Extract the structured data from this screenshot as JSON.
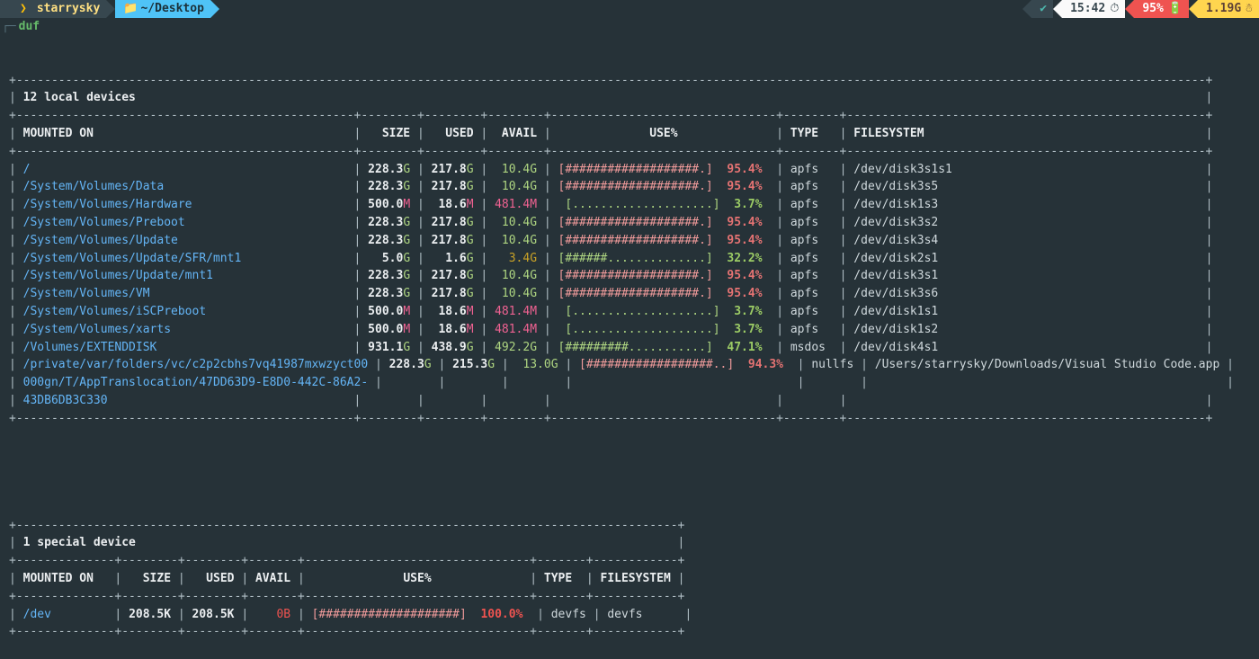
{
  "prompt": {
    "os_icon": "",
    "user": "starrysky",
    "dir_icon": "📁",
    "dir": "~/Desktop",
    "status_icon": "✔",
    "time": "15:42",
    "clock_icon": "◴",
    "battery_pct": "95%",
    "battery_icon": "🔋",
    "memory": "1.19G",
    "memory_icon": "⛁",
    "corner": "┌─",
    "command": "duf"
  },
  "local": {
    "title": "12 local devices",
    "columns": [
      "MOUNTED ON",
      "SIZE",
      "USED",
      "AVAIL",
      "USE%",
      "TYPE",
      "FILESYSTEM"
    ],
    "rows": [
      {
        "mount": "/",
        "size": "228.3G",
        "used": "217.8G",
        "avail": "10.4G",
        "avail_mag": "G",
        "bar_fill": 19,
        "bar_total": 20,
        "pct": "95.4%",
        "pct_level": "hi",
        "type": "apfs",
        "fs": "/dev/disk3s1s1"
      },
      {
        "mount": "/System/Volumes/Data",
        "size": "228.3G",
        "used": "217.8G",
        "avail": "10.4G",
        "avail_mag": "G",
        "bar_fill": 19,
        "bar_total": 20,
        "pct": "95.4%",
        "pct_level": "hi",
        "type": "apfs",
        "fs": "/dev/disk3s5"
      },
      {
        "mount": "/System/Volumes/Hardware",
        "size": "500.0M",
        "used": "18.6M",
        "avail": "481.4M",
        "avail_mag": "M",
        "bar_fill": 0,
        "bar_total": 20,
        "pct": "3.7%",
        "pct_level": "ok",
        "type": "apfs",
        "fs": "/dev/disk1s3"
      },
      {
        "mount": "/System/Volumes/Preboot",
        "size": "228.3G",
        "used": "217.8G",
        "avail": "10.4G",
        "avail_mag": "G",
        "bar_fill": 19,
        "bar_total": 20,
        "pct": "95.4%",
        "pct_level": "hi",
        "type": "apfs",
        "fs": "/dev/disk3s2"
      },
      {
        "mount": "/System/Volumes/Update",
        "size": "228.3G",
        "used": "217.8G",
        "avail": "10.4G",
        "avail_mag": "G",
        "bar_fill": 19,
        "bar_total": 20,
        "pct": "95.4%",
        "pct_level": "hi",
        "type": "apfs",
        "fs": "/dev/disk3s4"
      },
      {
        "mount": "/System/Volumes/Update/SFR/mnt1",
        "size": "5.0G",
        "used": "1.6G",
        "avail": "3.4G",
        "avail_mag": "dim",
        "bar_fill": 6,
        "bar_total": 20,
        "pct": "32.2%",
        "pct_level": "ok",
        "type": "apfs",
        "fs": "/dev/disk2s1"
      },
      {
        "mount": "/System/Volumes/Update/mnt1",
        "size": "228.3G",
        "used": "217.8G",
        "avail": "10.4G",
        "avail_mag": "G",
        "bar_fill": 19,
        "bar_total": 20,
        "pct": "95.4%",
        "pct_level": "hi",
        "type": "apfs",
        "fs": "/dev/disk3s1"
      },
      {
        "mount": "/System/Volumes/VM",
        "size": "228.3G",
        "used": "217.8G",
        "avail": "10.4G",
        "avail_mag": "G",
        "bar_fill": 19,
        "bar_total": 20,
        "pct": "95.4%",
        "pct_level": "hi",
        "type": "apfs",
        "fs": "/dev/disk3s6"
      },
      {
        "mount": "/System/Volumes/iSCPreboot",
        "size": "500.0M",
        "used": "18.6M",
        "avail": "481.4M",
        "avail_mag": "M",
        "bar_fill": 0,
        "bar_total": 20,
        "pct": "3.7%",
        "pct_level": "ok",
        "type": "apfs",
        "fs": "/dev/disk1s1"
      },
      {
        "mount": "/System/Volumes/xarts",
        "size": "500.0M",
        "used": "18.6M",
        "avail": "481.4M",
        "avail_mag": "M",
        "bar_fill": 0,
        "bar_total": 20,
        "pct": "3.7%",
        "pct_level": "ok",
        "type": "apfs",
        "fs": "/dev/disk1s2"
      },
      {
        "mount": "/Volumes/EXTENDDISK",
        "size": "931.1G",
        "used": "438.9G",
        "avail": "492.2G",
        "avail_mag": "G",
        "bar_fill": 9,
        "bar_total": 20,
        "pct": "47.1%",
        "pct_level": "ok",
        "type": "msdos",
        "fs": "/dev/disk4s1"
      },
      {
        "mount": "/private/var/folders/vc/c2p2cbhs7vq41987mxwzyct00",
        "mount_cont": [
          "000gn/T/AppTranslocation/47DD63D9-E8D0-442C-86A2-",
          "43DB6DB3C330"
        ],
        "size": "228.3G",
        "used": "215.3G",
        "avail": "13.0G",
        "avail_mag": "G",
        "bar_fill": 18,
        "bar_total": 20,
        "pct": "94.3%",
        "pct_level": "hi",
        "type": "nullfs",
        "fs": "/Users/starrysky/Downloads/Visual Studio Code.app"
      }
    ]
  },
  "special": {
    "title": "1 special device",
    "columns": [
      "MOUNTED ON",
      "SIZE",
      "USED",
      "AVAIL",
      "USE%",
      "TYPE",
      "FILESYSTEM"
    ],
    "rows": [
      {
        "mount": "/dev",
        "size": "208.5K",
        "used": "208.5K",
        "avail": "0B",
        "avail_mag": "zero",
        "bar_fill": 20,
        "bar_total": 20,
        "pct": "100.0%",
        "pct_level": "crit",
        "type": "devfs",
        "fs": "devfs"
      }
    ]
  },
  "theme": {
    "bg": "#263238",
    "border": "#b0bec5",
    "mount_color": "#64b5f6",
    "bar_high": "#ef9a9a",
    "bar_ok": "#aed581",
    "pct_high": "#e57373",
    "pct_ok": "#9ccc65"
  }
}
